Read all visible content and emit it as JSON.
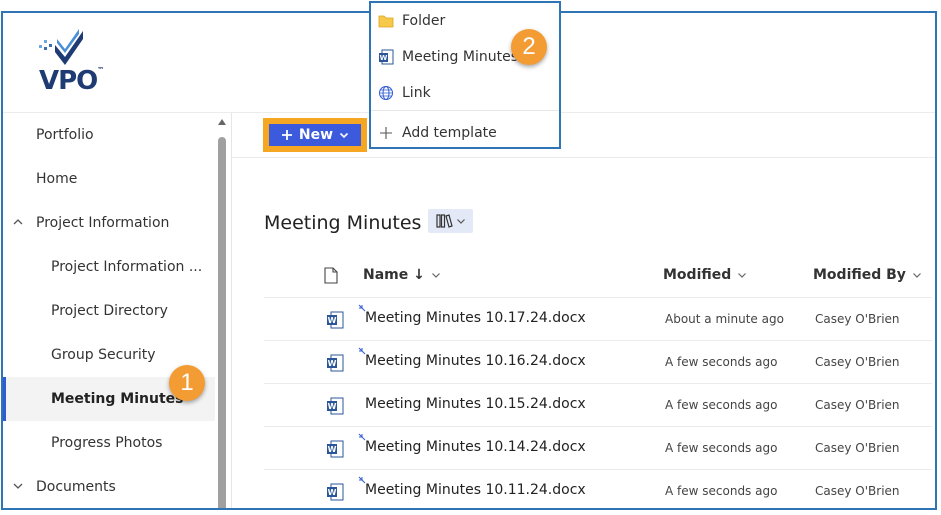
{
  "logo": {
    "text": "VPO",
    "tm": "™"
  },
  "sidebar": {
    "items": [
      {
        "label": "Portfolio"
      },
      {
        "label": "Home"
      },
      {
        "label": "Project Information"
      },
      {
        "label": "Project Information ..."
      },
      {
        "label": "Project Directory"
      },
      {
        "label": "Group Security"
      },
      {
        "label": "Meeting Minutes"
      },
      {
        "label": "Progress Photos"
      },
      {
        "label": "Documents"
      }
    ]
  },
  "toolbar": {
    "new_label": "New"
  },
  "dropdown": {
    "items": [
      {
        "label": "Folder",
        "icon": "folder-icon"
      },
      {
        "label": "Meeting Minutes",
        "icon": "word-doc-icon"
      },
      {
        "label": "Link",
        "icon": "globe-icon"
      },
      {
        "label": "Add template",
        "icon": "plus-icon"
      }
    ]
  },
  "badges": {
    "one": "1",
    "two": "2"
  },
  "library": {
    "title": "Meeting Minutes",
    "columns": {
      "name": "Name ↓",
      "modified": "Modified",
      "modified_by": "Modified By"
    },
    "rows": [
      {
        "name": "Meeting Minutes 10.17.24.docx",
        "modified": "About a minute ago",
        "modified_by": "Casey O'Brien",
        "is_new": true
      },
      {
        "name": "Meeting Minutes 10.16.24.docx",
        "modified": "A few seconds ago",
        "modified_by": "Casey O'Brien",
        "is_new": true
      },
      {
        "name": "Meeting Minutes 10.15.24.docx",
        "modified": "A few seconds ago",
        "modified_by": "Casey O'Brien",
        "is_new": false
      },
      {
        "name": "Meeting Minutes 10.14.24.docx",
        "modified": "A few seconds ago",
        "modified_by": "Casey O'Brien",
        "is_new": true
      },
      {
        "name": "Meeting Minutes 10.11.24.docx",
        "modified": "A few seconds ago",
        "modified_by": "Casey O'Brien",
        "is_new": true
      }
    ]
  },
  "colors": {
    "accent": "#3c5bdc",
    "highlight": "#f5a623",
    "frame": "#2e75b6",
    "badge": "#f39c34"
  }
}
